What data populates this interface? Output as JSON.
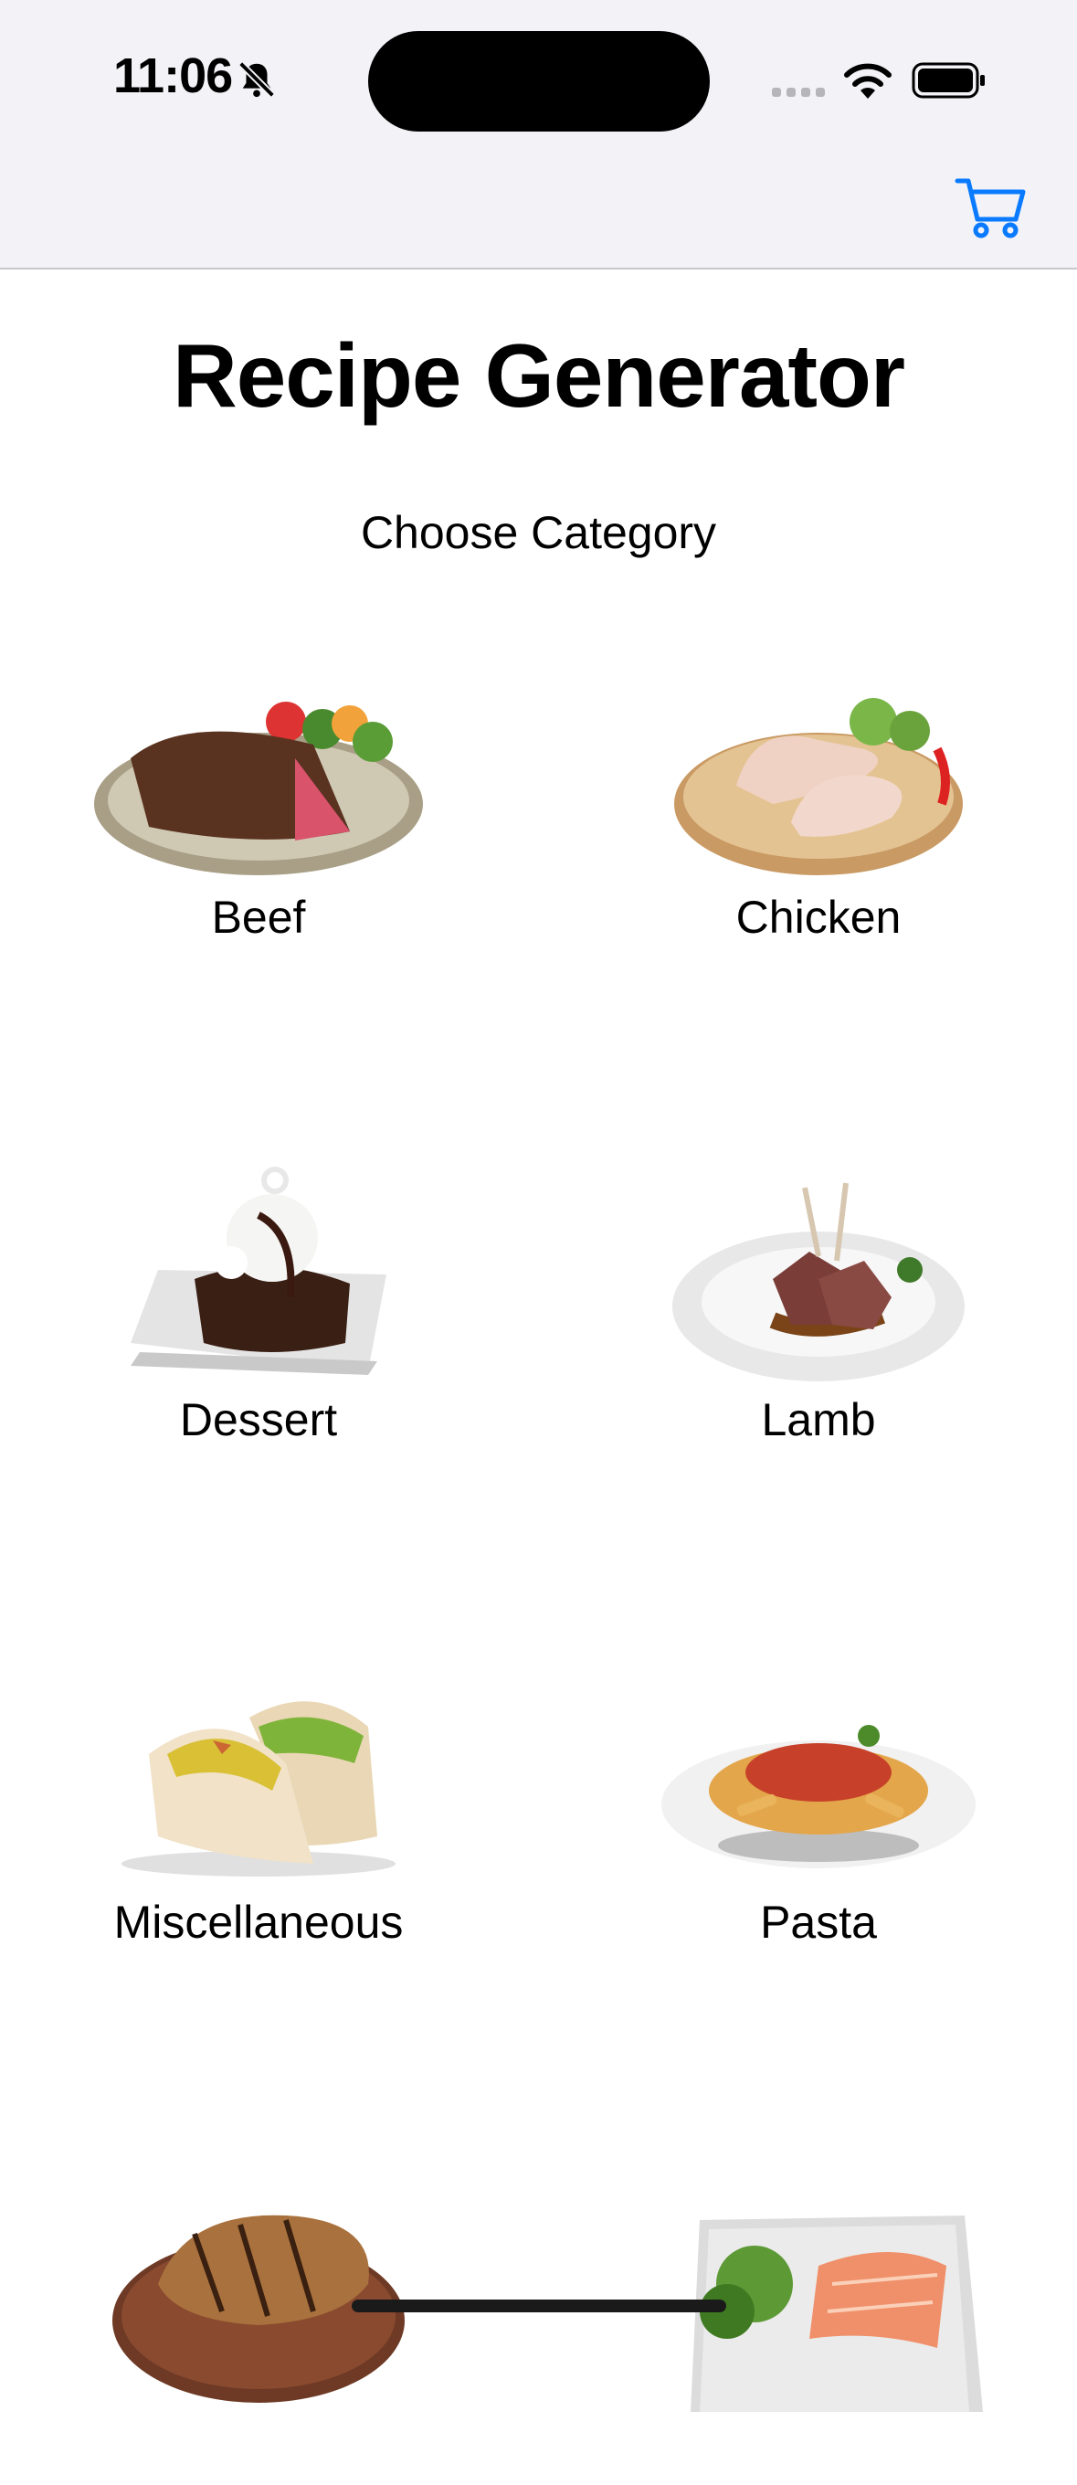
{
  "status_bar": {
    "time": "11:06",
    "icons": [
      "bell-slash-icon",
      "cellular-signal-icon",
      "wifi-icon",
      "battery-icon"
    ]
  },
  "nav": {
    "cart_icon": "cart-icon",
    "accent": "#0a7aff"
  },
  "title": "Recipe Generator",
  "subtitle": "Choose Category",
  "categories": [
    {
      "label": "Beef",
      "image": "steak-image"
    },
    {
      "label": "Chicken",
      "image": "chicken-legs-image"
    },
    {
      "label": "Dessert",
      "image": "brownie-sundae-image"
    },
    {
      "label": "Lamb",
      "image": "lamb-chops-image"
    },
    {
      "label": "Miscellaneous",
      "image": "tacos-image"
    },
    {
      "label": "Pasta",
      "image": "penne-pasta-image"
    },
    {
      "label": "",
      "image": "pork-chop-image"
    },
    {
      "label": "",
      "image": "salmon-plate-image"
    }
  ]
}
